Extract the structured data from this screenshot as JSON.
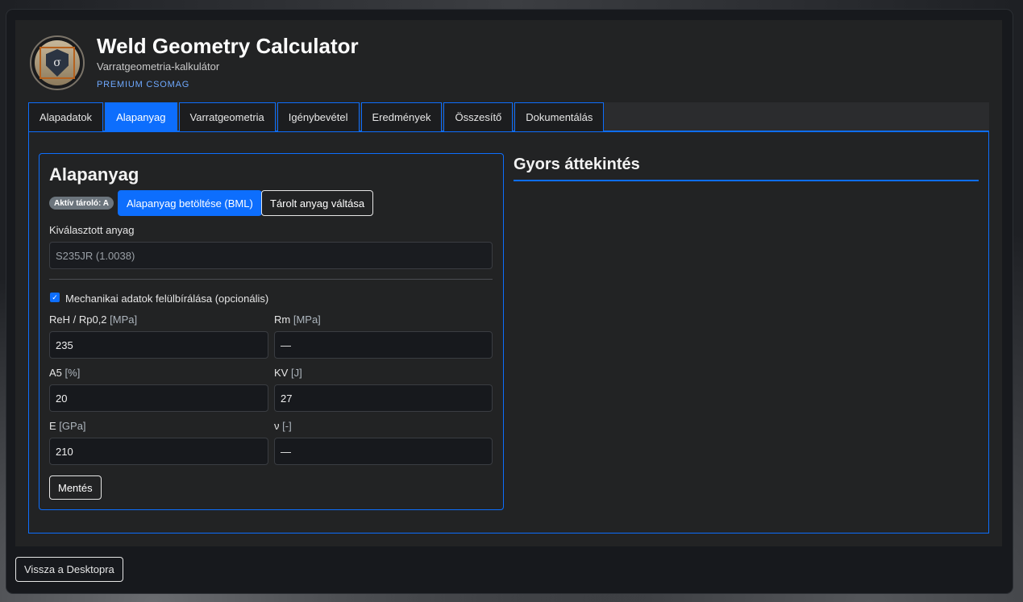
{
  "header": {
    "title": "Weld Geometry Calculator",
    "subtitle": "Varratgeometria-kalkulátor",
    "badge": "PREMIUM CSOMAG",
    "logo_symbol": "σ"
  },
  "tabs": [
    {
      "label": "Alapadatok",
      "active": false
    },
    {
      "label": "Alapanyag",
      "active": true
    },
    {
      "label": "Varratgeometria",
      "active": false
    },
    {
      "label": "Igénybevétel",
      "active": false
    },
    {
      "label": "Eredmények",
      "active": false
    },
    {
      "label": "Összesítő",
      "active": false
    },
    {
      "label": "Dokumentálás",
      "active": false
    }
  ],
  "material_card": {
    "title": "Alapanyag",
    "active_store_badge": "Aktív tároló: A",
    "load_button": "Alapanyag betöltése (BML)",
    "switch_button": "Tárolt anyag váltása",
    "selected_label": "Kiválasztott anyag",
    "selected_value": "S235JR (1.0038)",
    "override_checkbox_label": "Mechanikai adatok felülbírálása (opcionális)",
    "override_checked": true,
    "fields": {
      "reh": {
        "label": "ReH / Rp0,2",
        "unit": "[MPa]",
        "value": "235"
      },
      "rm": {
        "label": "Rm",
        "unit": "[MPa]",
        "value": "—"
      },
      "a5": {
        "label": "A5",
        "unit": "[%]",
        "value": "20"
      },
      "kv": {
        "label": "KV",
        "unit": "[J]",
        "value": "27"
      },
      "e": {
        "label": "E",
        "unit": "[GPa]",
        "value": "210"
      },
      "nu": {
        "label": "ν",
        "unit": "[-]",
        "value": "—"
      }
    },
    "save_button": "Mentés"
  },
  "overview": {
    "title": "Gyors áttekintés"
  },
  "footer": {
    "back_button": "Vissza a Desktopra"
  },
  "colors": {
    "accent": "#0d6efd",
    "link": "#6ea8fe",
    "panel": "#222324"
  }
}
